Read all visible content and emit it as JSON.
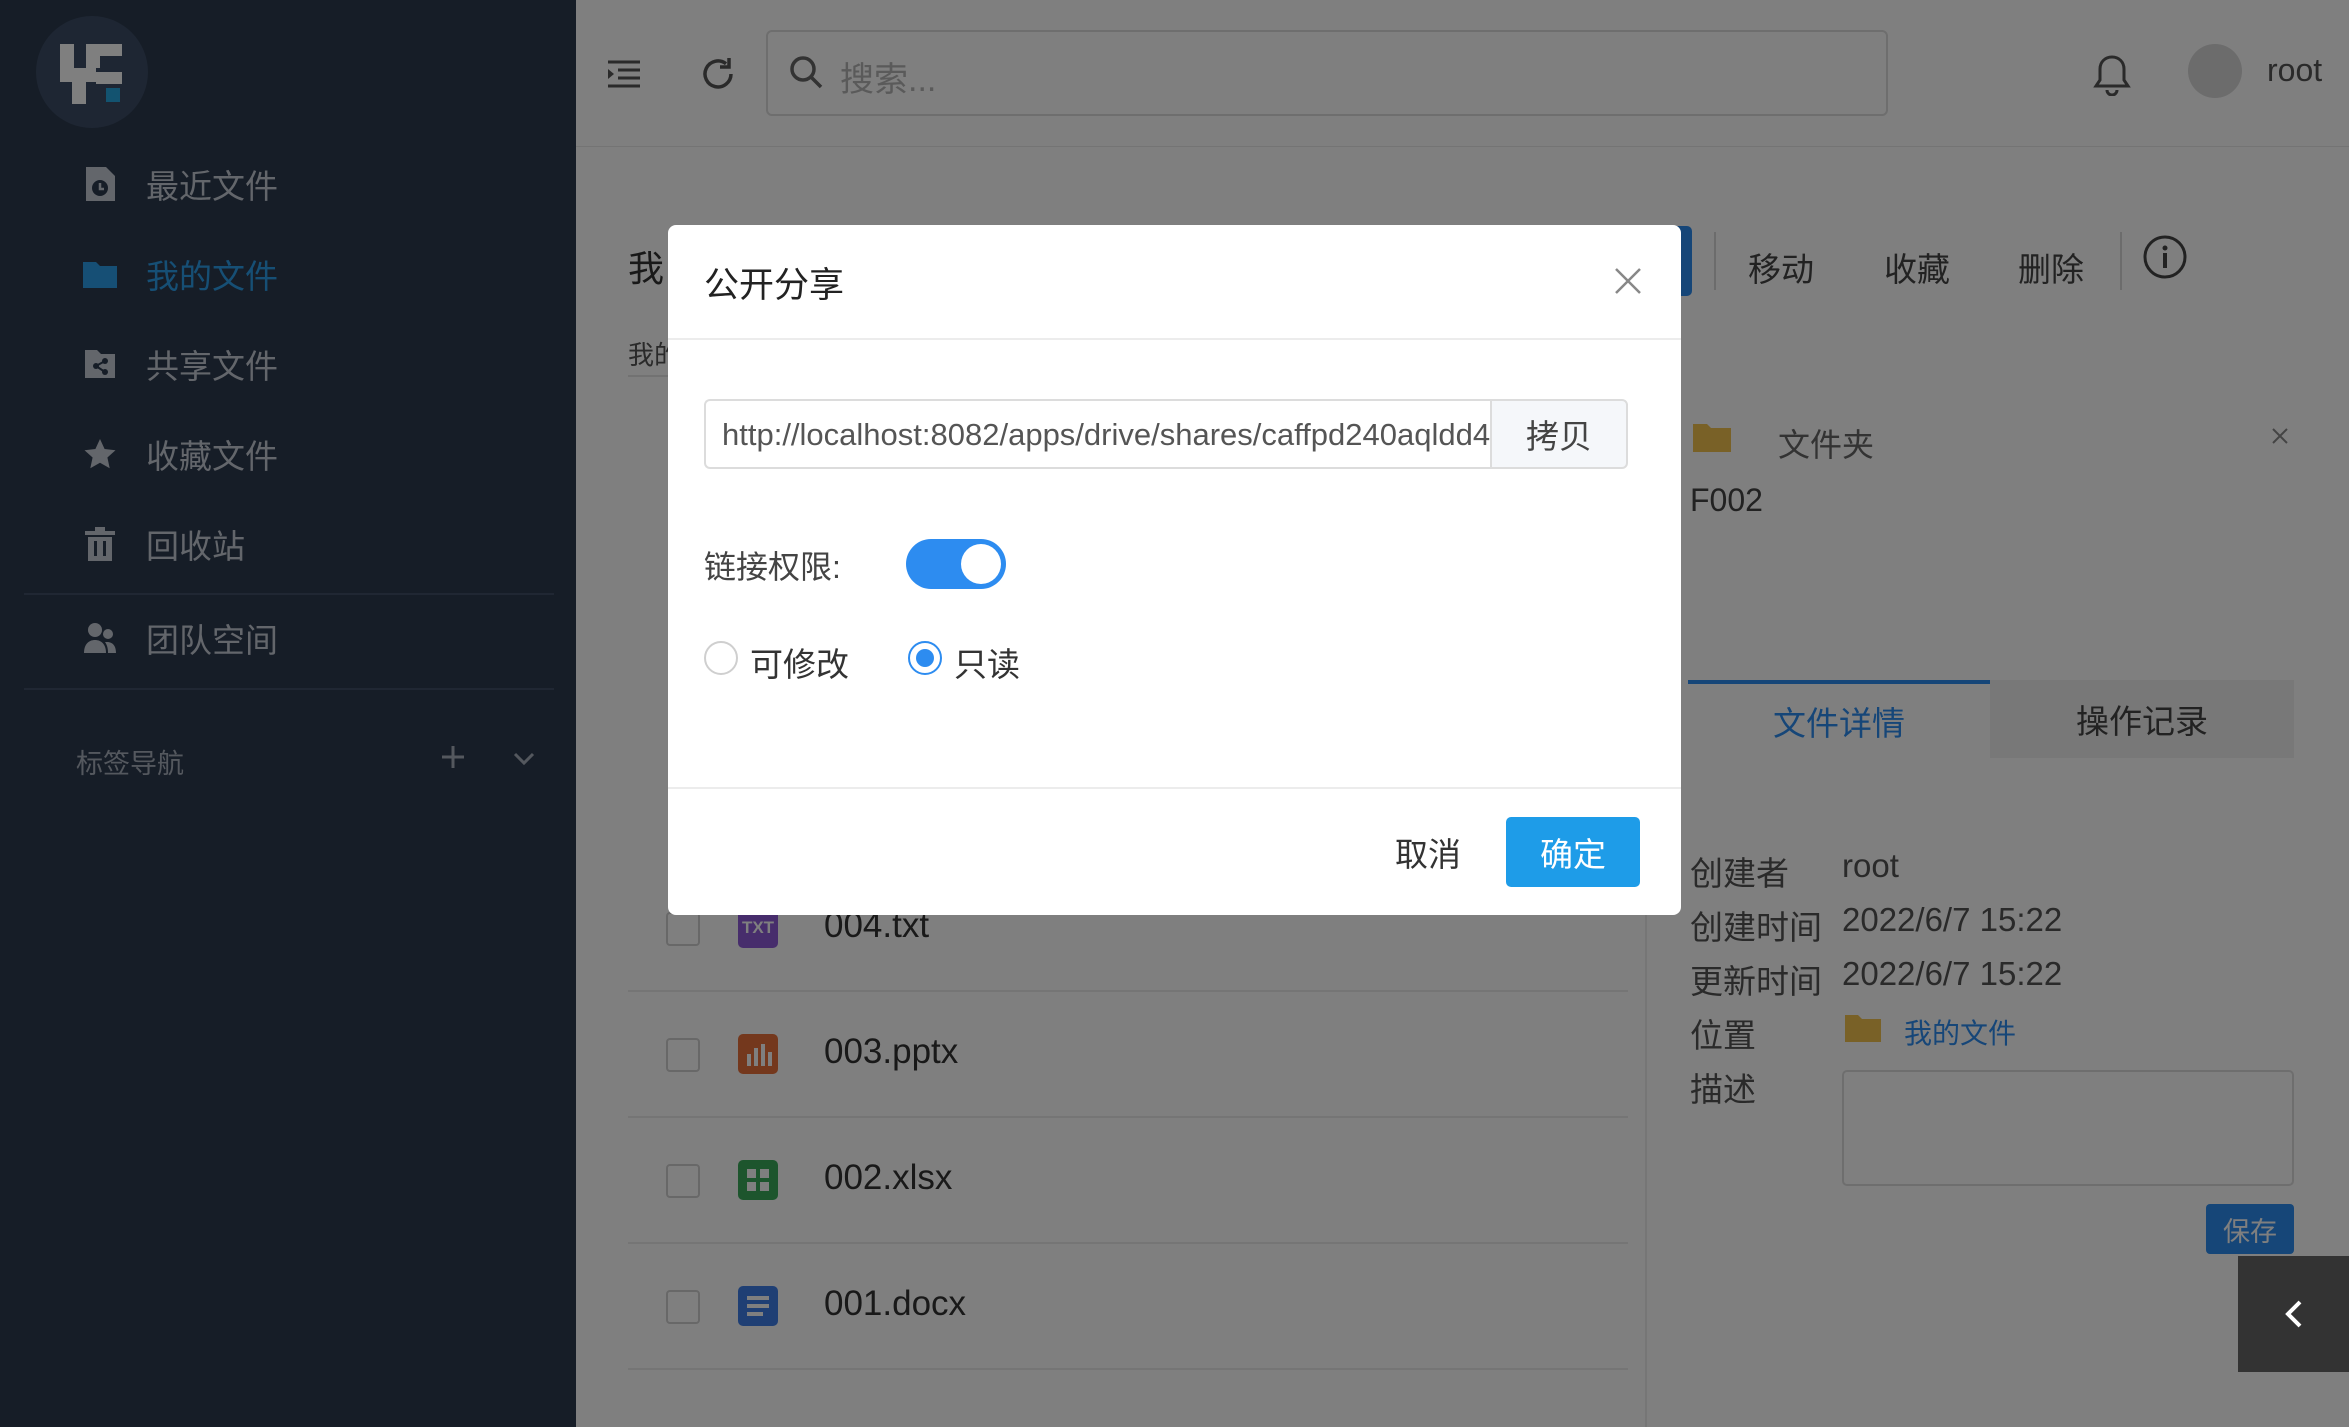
{
  "sidebar": {
    "items": [
      {
        "label": "最近文件",
        "icon": "recent-file-icon"
      },
      {
        "label": "我的文件",
        "icon": "folder-icon"
      },
      {
        "label": "共享文件",
        "icon": "share-file-icon"
      },
      {
        "label": "收藏文件",
        "icon": "star-icon"
      },
      {
        "label": "回收站",
        "icon": "trash-icon"
      },
      {
        "label": "团队空间",
        "icon": "team-icon"
      }
    ],
    "active_index": 1,
    "tag_nav_label": "标签导航"
  },
  "header": {
    "search_placeholder": "搜索...",
    "user_name": "root"
  },
  "content": {
    "page_title": "我",
    "breadcrumb": "我的",
    "toolbar": {
      "move": "移动",
      "favorite": "收藏",
      "delete": "删除"
    },
    "files": [
      {
        "name": "004.txt",
        "type_label": "TXT",
        "color": "#8e5bd8"
      },
      {
        "name": "003.pptx",
        "color": "#e8703a"
      },
      {
        "name": "002.xlsx",
        "color": "#3aab5b"
      },
      {
        "name": "001.docx",
        "color": "#3f7ee8"
      }
    ]
  },
  "detail": {
    "type_label": "文件夹",
    "name": "F002",
    "tabs": [
      "文件详情",
      "操作记录"
    ],
    "fields": {
      "creator_label": "创建者",
      "creator": "root",
      "created_label": "创建时间",
      "created": "2022/6/7 15:22",
      "updated_label": "更新时间",
      "updated": "2022/6/7 15:22",
      "location_label": "位置",
      "location": "我的文件",
      "description_label": "描述"
    },
    "save_label": "保存"
  },
  "modal": {
    "title": "公开分享",
    "url": "http://localhost:8082/apps/drive/shares/caffpd240aqldd4",
    "copy_label": "拷贝",
    "permission_label": "链接权限:",
    "permission_enabled": true,
    "options": [
      "可修改",
      "只读"
    ],
    "selected_option": "只读",
    "cancel_label": "取消",
    "confirm_label": "确定"
  },
  "colors": {
    "sidebar_bg": "#2d3a4f",
    "accent": "#2d8cf0",
    "primary_button": "#1e9ce8"
  }
}
